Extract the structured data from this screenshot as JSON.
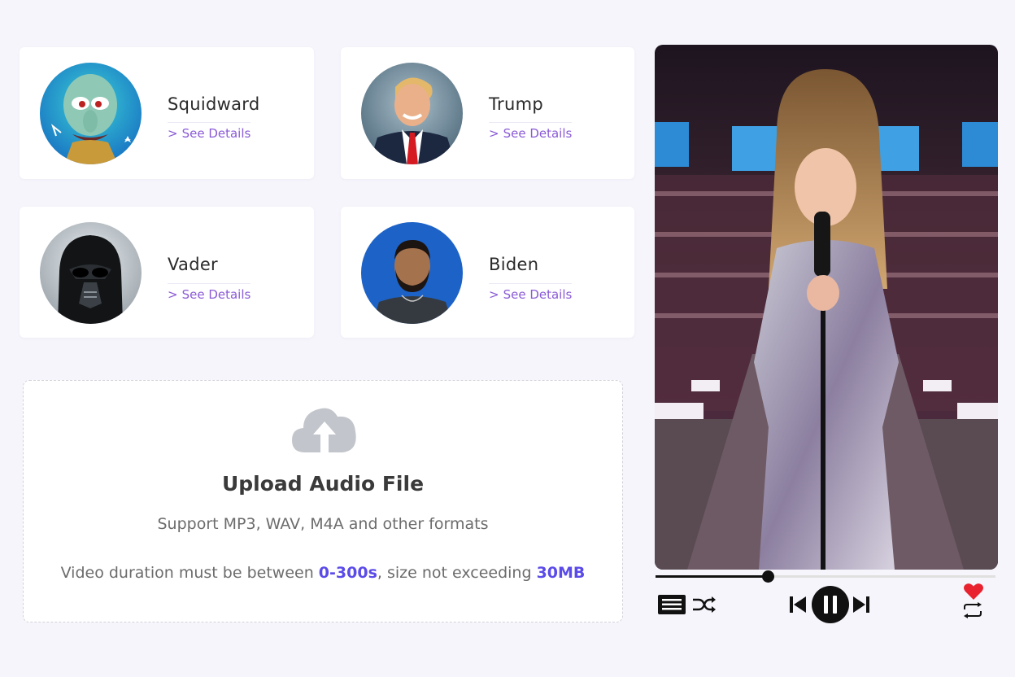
{
  "voices": [
    {
      "name": "Squidward",
      "details_label": "See Details",
      "avatar": "squidward-avatar"
    },
    {
      "name": "Trump",
      "details_label": "See Details",
      "avatar": "trump-avatar"
    },
    {
      "name": "Vader",
      "details_label": "See Details",
      "avatar": "vader-avatar"
    },
    {
      "name": "Biden",
      "details_label": "See Details",
      "avatar": "biden-avatar"
    }
  ],
  "upload": {
    "icon": "cloud-upload-icon",
    "title": "Upload Audio File",
    "subtitle": "Support MP3, WAV, M4A and other formats",
    "note_prefix": "Video duration must be between ",
    "duration_range": "0-300s",
    "note_middle": ", size not exceeding ",
    "size_limit": "30MB"
  },
  "player": {
    "cover": "singer-on-stage-image",
    "progress": 0.33,
    "controls": {
      "playlist": "playlist-icon",
      "shuffle": "shuffle-icon",
      "previous": "previous-icon",
      "pause": "pause-icon",
      "next": "next-icon",
      "like": "heart-icon",
      "repeat": "repeat-icon"
    }
  },
  "colors": {
    "accent": "#8a5bd6",
    "highlight": "#5b4be8",
    "like": "#e8232f",
    "background": "#f6f5fb"
  }
}
